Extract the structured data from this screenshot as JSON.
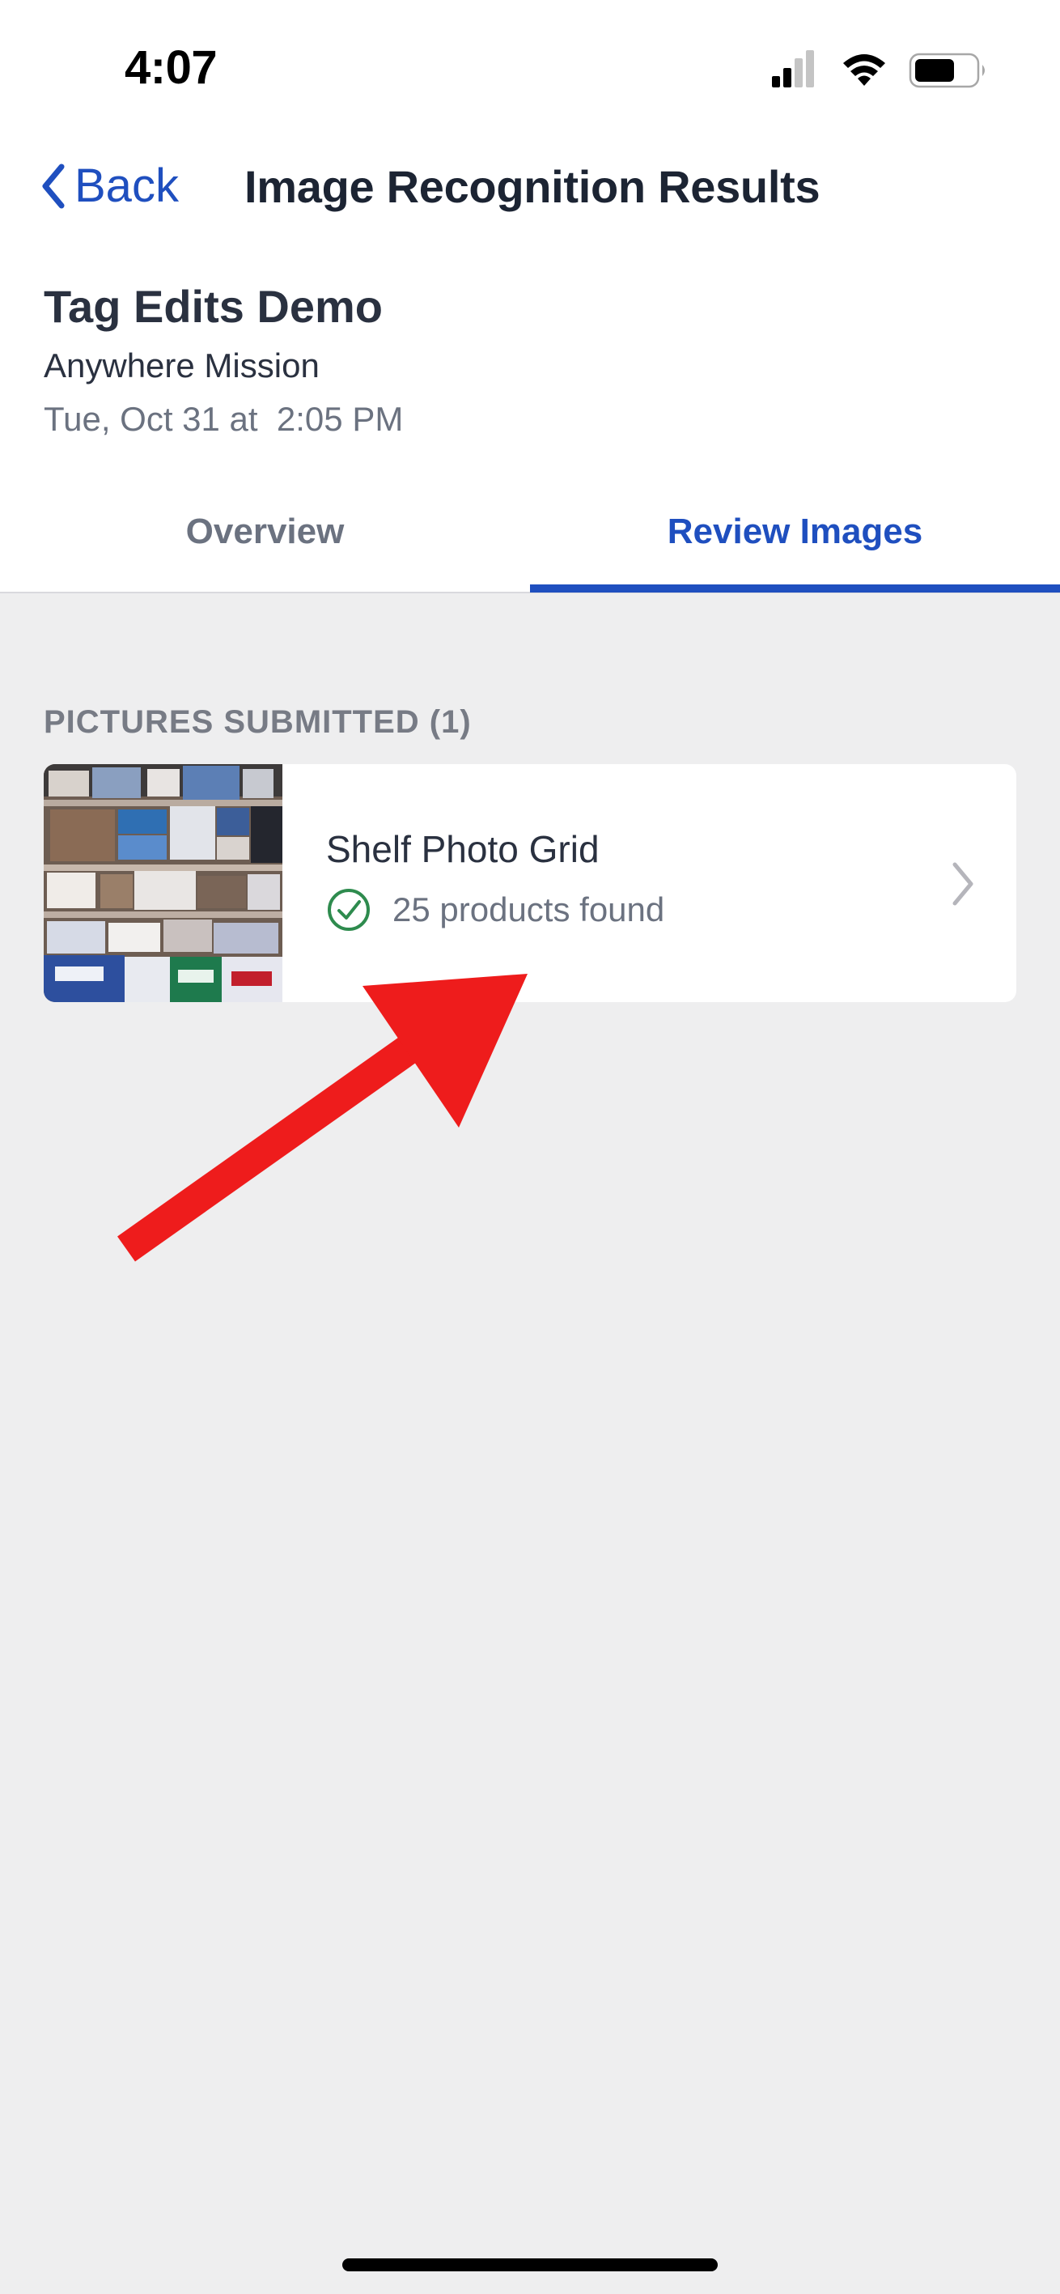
{
  "status_bar": {
    "time": "4:07",
    "icons": [
      "cellular-signal-icon",
      "wifi-icon",
      "battery-icon"
    ]
  },
  "nav": {
    "back_label": "Back",
    "title": "Image Recognition Results"
  },
  "mission": {
    "title": "Tag Edits Demo",
    "subtitle": "Anywhere Mission",
    "date": "Tue, Oct 31 at  2:05 PM"
  },
  "tabs": [
    {
      "label": "Overview",
      "selected": false
    },
    {
      "label": "Review Images",
      "selected": true
    }
  ],
  "pictures": {
    "section_label": "PICTURES SUBMITTED (1)",
    "items": [
      {
        "title": "Shelf Photo Grid",
        "status_text": "25 products found",
        "status_icon": "check-circle-icon",
        "chevron_icon": "chevron-right-icon"
      }
    ]
  },
  "colors": {
    "accent": "#1f4fbf",
    "success": "#2e8b4e",
    "annotation": "#ee1c1c",
    "background": "#eeeeef"
  }
}
